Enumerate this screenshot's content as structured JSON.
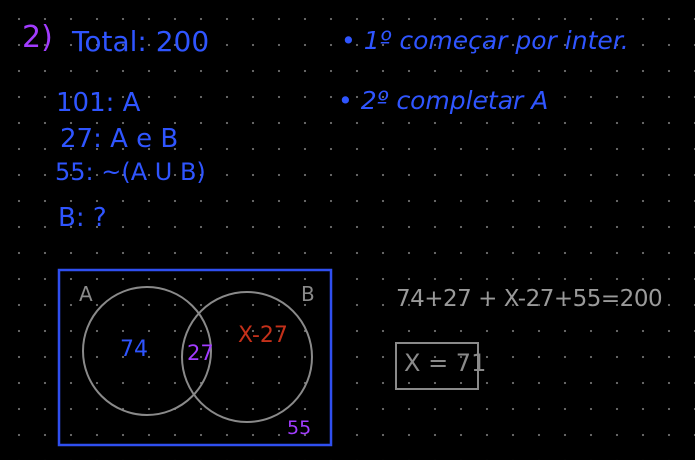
{
  "problem": {
    "number": "2)",
    "total": "Total: 200"
  },
  "steps": [
    "• 1º começar por inter.",
    "• 2º completar A"
  ],
  "given": [
    "101: A",
    "27: A e B",
    "55: ~(A U B)"
  ],
  "question": "B: ?",
  "venn": {
    "label_a": "A",
    "label_b": "B",
    "only_a": "74",
    "intersection": "27",
    "only_b": "X-27",
    "outside": "55"
  },
  "equation": "74+27 + X-27+55=200",
  "answer": "X = 71",
  "colors": {
    "blue": "#2f55ff",
    "violet": "#a23cff",
    "red": "#c4301a",
    "gray": "#8a8a8a"
  }
}
